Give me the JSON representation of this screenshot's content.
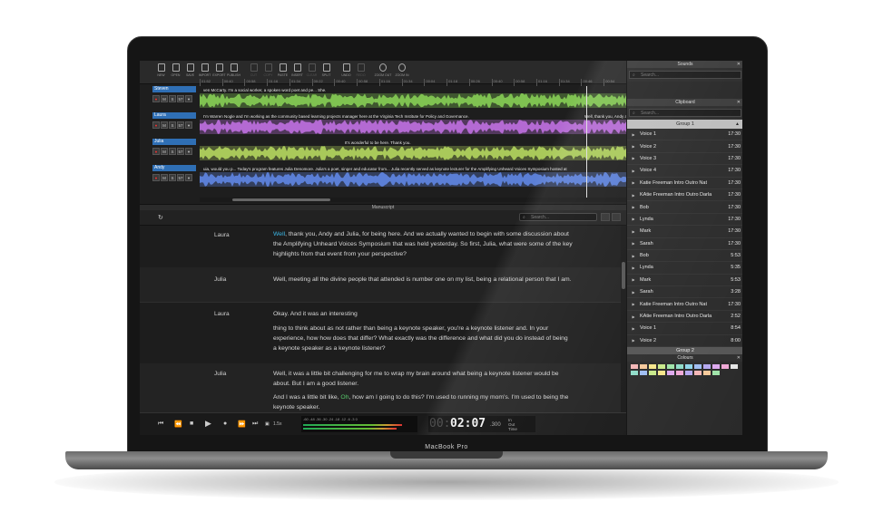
{
  "device_label": "MacBook Pro",
  "toolbar": [
    {
      "label": "NEW",
      "icon": "new-file-icon",
      "enabled": true
    },
    {
      "label": "OPEN",
      "icon": "open-folder-icon",
      "enabled": true
    },
    {
      "label": "SAVE",
      "icon": "save-icon",
      "enabled": true
    },
    {
      "label": "IMPORT",
      "icon": "import-icon",
      "enabled": true
    },
    {
      "label": "EXPORT",
      "icon": "export-icon",
      "enabled": true
    },
    {
      "label": "PUBLISH",
      "icon": "publish-cloud-icon",
      "enabled": true
    },
    {
      "label": "CUT",
      "icon": "cut-icon",
      "enabled": false
    },
    {
      "label": "COPY",
      "icon": "copy-icon",
      "enabled": false
    },
    {
      "label": "PASTE",
      "icon": "paste-icon",
      "enabled": true
    },
    {
      "label": "INSERT",
      "icon": "insert-icon",
      "enabled": true
    },
    {
      "label": "CLEAR",
      "icon": "clear-icon",
      "enabled": false
    },
    {
      "label": "SPLIT",
      "icon": "split-icon",
      "enabled": true
    },
    {
      "label": "UNDO",
      "icon": "undo-icon",
      "enabled": true
    },
    {
      "label": "REDO",
      "icon": "redo-icon",
      "enabled": false
    },
    {
      "label": "ZOOM OUT",
      "icon": "zoom-out-icon",
      "enabled": true
    },
    {
      "label": "ZOOM IN",
      "icon": "zoom-in-icon",
      "enabled": true
    }
  ],
  "ruler_ticks": [
    "01:52",
    "00:40",
    "00:58",
    "01:16",
    "01:34",
    "00:22",
    "00:40",
    "00:58",
    "01:16",
    "01:34",
    "00:04",
    "01:18",
    "00:26",
    "00:40",
    "00:58",
    "01:16",
    "01:34",
    "00:46",
    "00:54"
  ],
  "tracks": [
    {
      "name": "Steven",
      "tag_color": "#2f6fb5",
      "wave_color": "#7fc251",
      "caption": "ven McCarty. I'm a social worker, a spoken word poet and pe... She."
    },
    {
      "name": "Laura",
      "tag_color": "#2f6fb5",
      "wave_color": "#b46ad3",
      "caption": "I'm Warren Nogle and I'm working as the community based learning projects manager here at the Virginia Tech Institute for Policy and Governance.",
      "caption_right": "Well, thank you, Andy and"
    },
    {
      "name": "Julia",
      "tag_color": "#2f6fb5",
      "wave_color": "#a9c95a",
      "caption": "It's wonderful to be here. Thank you."
    },
    {
      "name": "Andy",
      "tag_color": "#2f6fb5",
      "wave_color": "#5b7fd6",
      "caption": "uia, would you p... Today's program features Julia Denomore. Julia's a poet, singer and educator from... Julia recently served as keynote lecturer for the Amplifying Unheard Voices Symposium hosted at"
    }
  ],
  "track_controls": [
    "●",
    "M",
    "S",
    "57",
    "▾"
  ],
  "manuscript": {
    "title": "Manuscript",
    "search_placeholder": "Search...",
    "rows": [
      {
        "speaker": "Laura",
        "hl": "Well",
        "text": ", thank you, Andy and Julia, for being here. And we actually wanted to begin with some discussion about the Amplifying Unheard Voices Symposium that was held yesterday. So first, Julia, what were some of the key highlights from that event from your perspective?"
      },
      {
        "speaker": "Julia",
        "text": "Well, meeting all the divine people that attended is number one on my list, being a relational person that I am."
      },
      {
        "speaker": "Laura",
        "text": "Okay. And it was an interesting",
        "text2": "thing to think about as not rather than being a keynote speaker, you're a keynote listener and. In your experience, how how does that differ? What exactly was the difference and what did you do instead of being a keynote speaker as a keynote listener?"
      },
      {
        "speaker": "Julia",
        "text": "Well, it was a little bit challenging for me to wrap my brain around what being a keynote listener would be about. But I am a good listener.",
        "text2a": "And I was a little bit like, ",
        "hl": "Oh",
        "text2b": ", how am I going to do this? I'm used to running my mom's. I'm used to being the keynote speaker."
      }
    ]
  },
  "transport": {
    "speed": "1.5x",
    "meter_scale": "-60  -48  -36  -30  -24  -18  -12   -6   -3    0",
    "meter_level_left": 0.88,
    "meter_level_right": 0.83,
    "time_prefix": "00:",
    "time": "02:07",
    "ms": ".300",
    "labels": [
      "In",
      "Out",
      "Time"
    ]
  },
  "panel": {
    "sounds_title": "Sounds",
    "clipboard_title": "Clipboard",
    "search_placeholder": "Search...",
    "group1": "Group 1",
    "group2": "Group 2",
    "items": [
      {
        "name": "Voice 1",
        "dur": "17:30"
      },
      {
        "name": "Voice 2",
        "dur": "17:30"
      },
      {
        "name": "Voice 3",
        "dur": "17:30"
      },
      {
        "name": "Voice 4",
        "dur": "17:30"
      },
      {
        "name": "Katie Freeman Intro Outro Nat",
        "dur": "17:30"
      },
      {
        "name": "KAtie Freeman Intro Outro Darla",
        "dur": "17:30"
      },
      {
        "name": "Bob",
        "dur": "17:30"
      },
      {
        "name": "Lynda",
        "dur": "17:30"
      },
      {
        "name": "Mark",
        "dur": "17:30"
      },
      {
        "name": "Sarah",
        "dur": "17:30"
      },
      {
        "name": "Bob",
        "dur": "5:53"
      },
      {
        "name": "Lynda",
        "dur": "5:35"
      },
      {
        "name": "Mark",
        "dur": "5:53"
      },
      {
        "name": "Sarah",
        "dur": "3:28"
      },
      {
        "name": "Katie Freeman Intro Outro Nat",
        "dur": "17:30"
      },
      {
        "name": "KAtie Freeman Intro Outro Darla",
        "dur": "2:52"
      },
      {
        "name": "Voice 1",
        "dur": "8:54"
      },
      {
        "name": "Voice 2",
        "dur": "8:00"
      }
    ],
    "colours_title": "Colours",
    "colours": [
      "#f4b6b6",
      "#f7c99a",
      "#f6e58a",
      "#c9ea8a",
      "#9fe3a8",
      "#8fdcc8",
      "#8fd6ea",
      "#9fbdf2",
      "#b5a8f0",
      "#dda8ee",
      "#f0a8d6",
      "#e6e6e6",
      "#8fdcc8",
      "#9fbdf2",
      "#c9ea8a",
      "#f6e58a",
      "#dda8ee",
      "#f0a8d6",
      "#b5a8f0",
      "#f4b6b6",
      "#f7c99a",
      "#9fe3a8"
    ]
  }
}
